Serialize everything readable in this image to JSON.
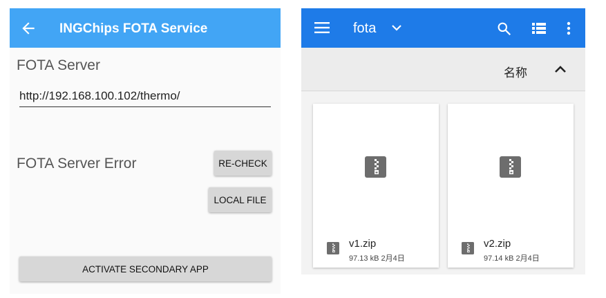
{
  "left": {
    "app_title": "INGChips FOTA Service",
    "server_label": "FOTA Server",
    "server_value": "http://192.168.100.102/thermo/",
    "error_label": "FOTA Server Error",
    "recheck_label": "RE-CHECK",
    "local_file_label": "LOCAL FILE",
    "activate_label": "ACTIVATE SECONDARY APP",
    "colors": {
      "app_bar": "#42a5f5",
      "button": "#d7d7d7"
    }
  },
  "right": {
    "folder_title": "fota",
    "sort_label": "名称",
    "files": [
      {
        "name": "v1.zip",
        "meta": "97.13 kB 2月4日"
      },
      {
        "name": "v2.zip",
        "meta": "97.14 kB 2月4日"
      }
    ],
    "icons": [
      "menu-icon",
      "chevron-down-icon",
      "search-icon",
      "list-view-icon",
      "more-vert-icon",
      "sort-ascending-icon",
      "zip-file-icon"
    ],
    "colors": {
      "app_bar": "#1e7be8",
      "sort_bar": "#ececec"
    }
  }
}
